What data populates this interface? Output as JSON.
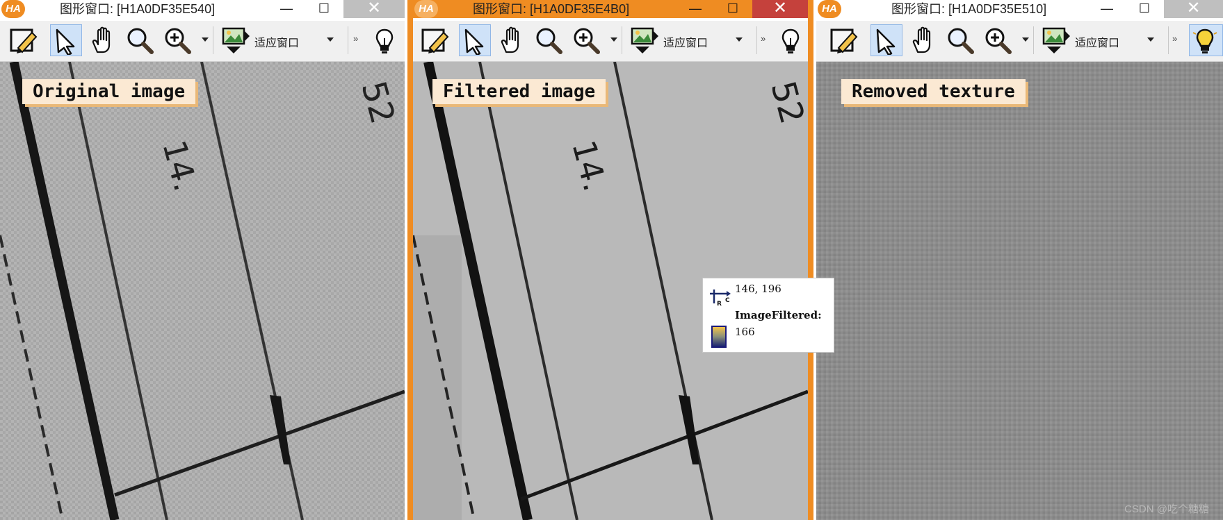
{
  "windows": [
    {
      "title": "图形窗口: [H1A0DF35E540]",
      "overlay_label": "Original image",
      "active": false,
      "fit_label": "适应窗口"
    },
    {
      "title": "图形窗口: [H1A0DF35E4B0]",
      "overlay_label": "Filtered image",
      "active": true,
      "fit_label": "适应窗口"
    },
    {
      "title": "图形窗口: [H1A0DF35E510]",
      "overlay_label": "Removed texture",
      "active": false,
      "fit_label": "适应窗口"
    }
  ],
  "window_buttons": {
    "minimize": "—",
    "maximize": "☐",
    "close": "✕"
  },
  "logo_text": "HA",
  "toolbar_icons": [
    "edit-icon",
    "pointer-icon",
    "pan-hand-icon",
    "magnifier-icon",
    "zoom-in-icon",
    "fit-window-icon",
    "more-icon",
    "lightbulb-icon"
  ],
  "more_glyph": "»",
  "tooltip": {
    "coords": "146,  196",
    "image_name": "ImageFiltered:",
    "value": "166"
  },
  "canvas_text": {
    "digits_top": "52",
    "digits_mid": "14."
  },
  "watermark": "CSDN @吃个糖糖",
  "colors": {
    "accent": "#ef8c22",
    "selected_tool": "#cfe2f8",
    "active_close": "#c5413c"
  }
}
